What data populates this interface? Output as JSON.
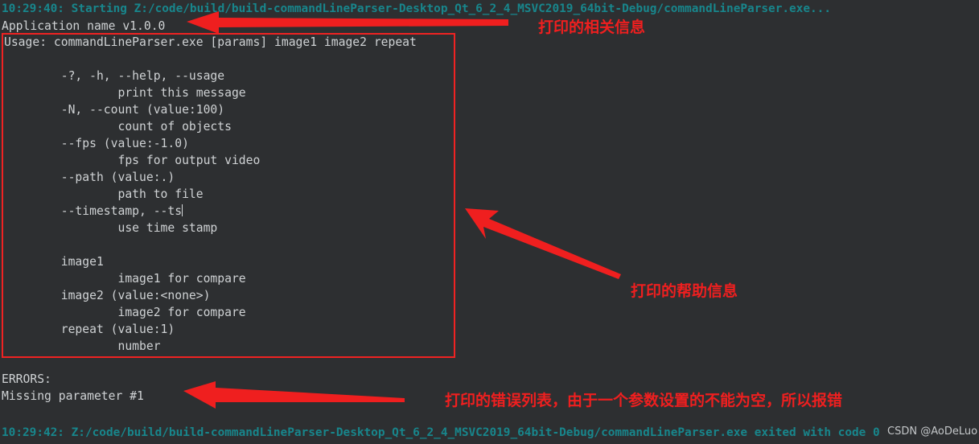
{
  "theme": {
    "background": "#2d2f31",
    "timestamp_color": "#18868c",
    "output_color": "#cfd2d4",
    "annotation_color": "#ef1f1f"
  },
  "console": {
    "start_line": "10:29:40: Starting Z:/code/build/build-commandLineParser-Desktop_Qt_6_2_4_MSVC2019_64bit-Debug/commandLineParser.exe...",
    "app_name_line": "Application name v1.0.0",
    "help_lines": [
      "Usage: commandLineParser.exe [params] image1 image2 repeat",
      "",
      "        -?, -h, --help, --usage",
      "                print this message",
      "        -N, --count (value:100)",
      "                count of objects",
      "        --fps (value:-1.0)",
      "                fps for output video",
      "        --path (value:.)",
      "                path to file",
      "        --timestamp, --ts",
      "                use time stamp",
      "",
      "        image1",
      "                image1 for compare",
      "        image2 (value:<none>)",
      "                image2 for compare",
      "        repeat (value:1)",
      "                number"
    ],
    "caret_after_line_index": 10,
    "error_lines": [
      "ERRORS:",
      "Missing parameter #1"
    ],
    "exit_line": "10:29:42: Z:/code/build/build-commandLineParser-Desktop_Qt_6_2_4_MSVC2019_64bit-Debug/commandLineParser.exe exited with code 0"
  },
  "annotations": {
    "info_label": "打印的相关信息",
    "help_label": "打印的帮助信息",
    "error_label": "打印的错误列表，由于一个参数设置的不能为空，所以报错"
  },
  "watermark": {
    "text": "CSDN @AoDeLuo"
  }
}
